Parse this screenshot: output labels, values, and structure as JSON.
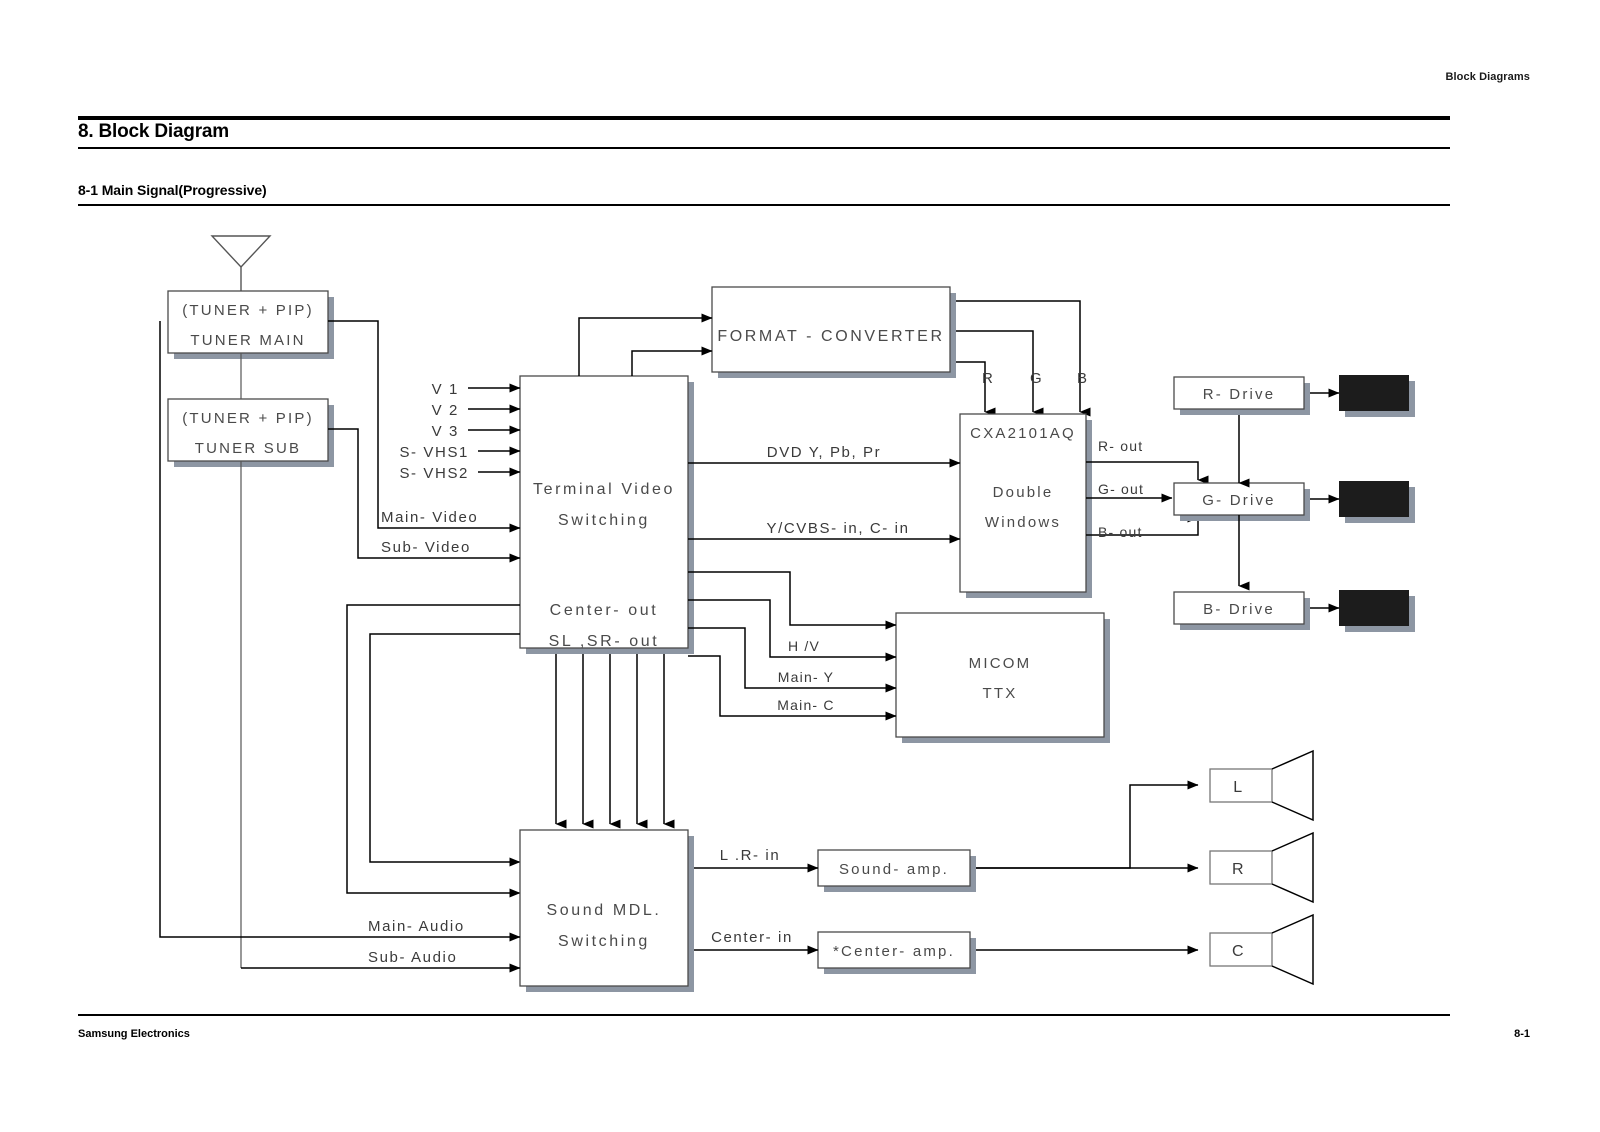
{
  "page": {
    "header_right": "Block Diagrams",
    "section_title": "8. Block Diagram",
    "subsection_title": "8-1  Main Signal(Progressive)",
    "footer_left": "Samsung Electronics",
    "footer_right": "8-1"
  },
  "diagram": {
    "blocks": {
      "tuner_main_line1": "(TUNER + PIP)",
      "tuner_main_line2": "TUNER MAIN",
      "tuner_sub_line1": "(TUNER + PIP)",
      "tuner_sub_line2": "TUNER SUB",
      "terminal_video_line1": "Terminal Video",
      "terminal_video_line2": "Switching",
      "terminal_center_out": "Center- out",
      "terminal_slsr_out": "SL ,SR- out",
      "format_converter": "FORMAT - CONVERTER",
      "cxa_chip": "CXA2101AQ",
      "cxa_line1": "Double",
      "cxa_line2": "Windows",
      "micom_line1": "MICOM",
      "micom_line2": "TTX",
      "r_drive": "R- Drive",
      "g_drive": "G- Drive",
      "b_drive": "B- Drive",
      "sound_mdl_line1": "Sound MDL.",
      "sound_mdl_line2": "Switching",
      "sound_amp": "Sound- amp.",
      "center_amp": "*Center- amp."
    },
    "inputs": {
      "v1": "V 1",
      "v2": "V 2",
      "v3": "V 3",
      "svhs1": "S- VHS1",
      "svhs2": "S- VHS2",
      "main_video": "Main- Video",
      "sub_video": "Sub- Video",
      "main_audio": "Main- Audio",
      "sub_audio": "Sub- Audio"
    },
    "signals": {
      "dvd": "DVD Y, Pb, Pr",
      "ycvbs": "Y/CVBS- in, C- in",
      "hv": "H /V",
      "main_y": "Main- Y",
      "main_c": "Main- C",
      "lr_in": "L .R- in",
      "center_in": "Center- in",
      "r_tap": "R",
      "g_tap": "G",
      "b_tap": "B",
      "r_out": "R- out",
      "g_out": "G- out",
      "b_out": "B- out"
    },
    "speakers": {
      "left": "L",
      "right": "R",
      "center": "C"
    }
  }
}
